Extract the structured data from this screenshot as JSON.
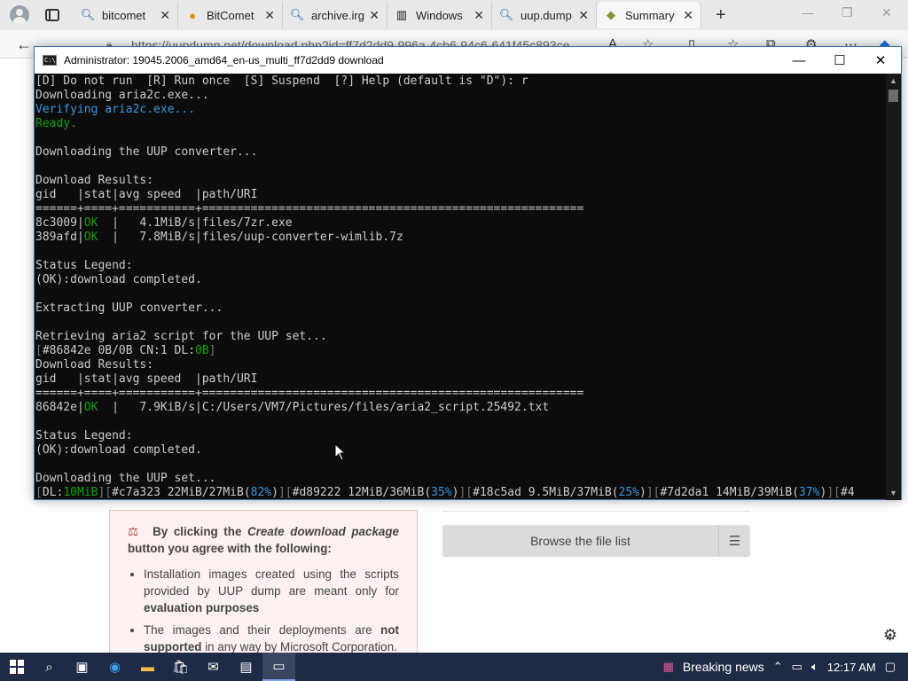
{
  "browser": {
    "tabs": [
      {
        "title": "bitcomet",
        "icon": "search-icon"
      },
      {
        "title": "BitComet",
        "icon": "bitcomet-favicon-icon"
      },
      {
        "title": "archive.irg",
        "icon": "search-icon"
      },
      {
        "title": "Windows",
        "icon": "archive-favicon-icon"
      },
      {
        "title": "uup.dump",
        "icon": "search-icon"
      },
      {
        "title": "Summary",
        "icon": "uupdump-favicon-icon"
      }
    ],
    "url": "https://uupdump.net/download.php?id=ff7d2dd9-996a-4cb6-94c6-641f45c893ce"
  },
  "console": {
    "title": "Administrator:  19045.2006_amd64_en-us_multi_ff7d2dd9 download",
    "lines": {
      "l1": "[D] Do not run  [R] Run once  [S] Suspend  [?] Help (default is \"D\"): r",
      "l2": "Downloading aria2c.exe...",
      "l3": "Verifying aria2c.exe...",
      "l4": "Ready.",
      "l5": "Downloading the UUP converter...",
      "l6": "Download Results:",
      "l7": "gid   |stat|avg speed  |path/URI",
      "l8": "======+====+===========+=======================================================",
      "r1_gid": "8c3009",
      "r1_stat": "OK",
      "r1_rest": "  |   4.1MiB/s|files/7zr.exe",
      "r2_gid": "389afd",
      "r2_stat": "OK",
      "r2_rest": "  |   7.8MiB/s|files/uup-converter-wimlib.7z",
      "l9": "Status Legend:",
      "l10": "(OK):download completed.",
      "l11": "Extracting UUP converter...",
      "l12": "Retrieving aria2 script for the UUP set...",
      "l13a": "[",
      "l13b": "#86842e 0B/0B CN:1 DL:",
      "l13c": "0B",
      "l13d": "]",
      "l14": "Download Results:",
      "l15": "gid   |stat|avg speed  |path/URI",
      "l16": "======+====+===========+=======================================================",
      "r3_gid": "86842e",
      "r3_stat": "OK",
      "r3_rest": "  |   7.9KiB/s|C:/Users/VM7/Pictures/files/aria2_script.25492.txt",
      "l17": "Status Legend:",
      "l18": "(OK):download completed.",
      "l19": "Downloading the UUP set...",
      "p_dl_label": "DL:",
      "p_dl_val": "10MiB",
      "p1": "#c7a323 22MiB/27MiB",
      "p1pct": "82%",
      "p2": "#d89222 12MiB/36MiB",
      "p2pct": "35%",
      "p3": "#18c5ad 9.5MiB/37MiB",
      "p3pct": "25%",
      "p4": "#7d2da1 14MiB/39MiB",
      "p4pct": "37%",
      "p5": "#4"
    }
  },
  "page": {
    "notice_lead_1": "By clicking the",
    "notice_lead_em": "Create download package",
    "notice_lead_2": "button you agree with the following:",
    "bullet1_a": "Installation images created using the scripts provided by UUP dump are meant only for",
    "bullet1_b": "evaluation purposes",
    "bullet2_a": "The images and their deployments are",
    "bullet2_b": "not supported",
    "bullet2_c": "in any way by Microsoft Corporation.",
    "browse_label": "Browse the file list"
  },
  "taskbar": {
    "news": "Breaking news",
    "time": "12:17 AM"
  }
}
